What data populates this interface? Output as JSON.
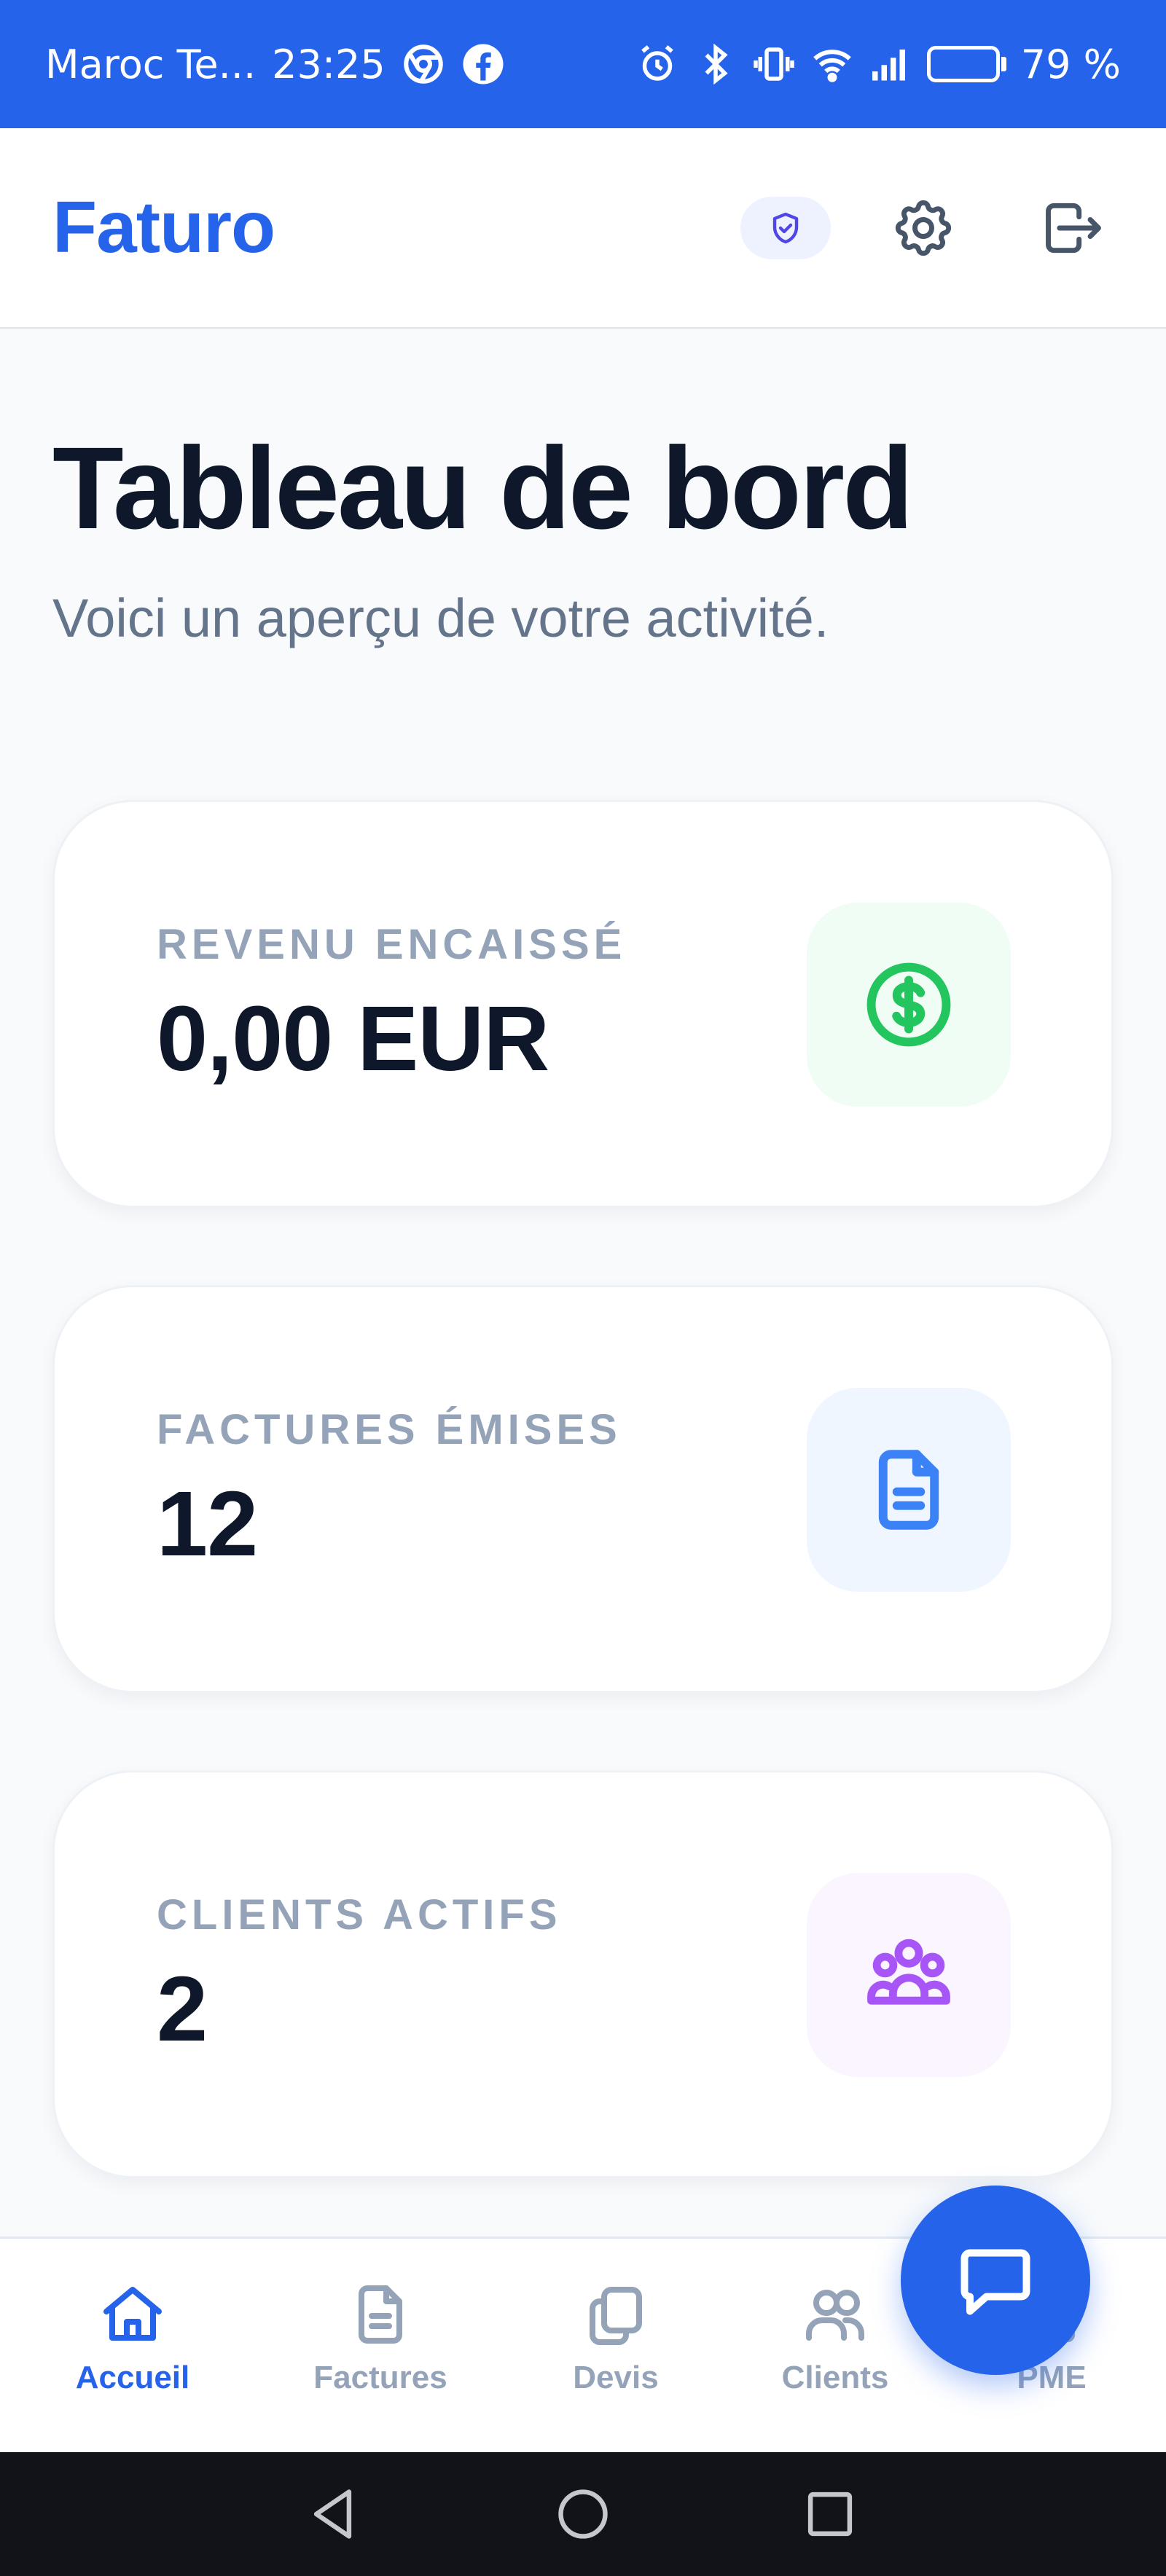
{
  "status_bar": {
    "carrier": "Maroc Te...",
    "time": "23:25",
    "battery": "79 %",
    "battery_level": 0.79,
    "icons": [
      "chrome-icon",
      "facebook-icon",
      "alarm-icon",
      "bluetooth-icon",
      "vibrate-icon",
      "wifi-icon",
      "signal-icon",
      "battery-icon"
    ]
  },
  "header": {
    "brand": "Faturo",
    "icons": [
      "shield-icon",
      "gear-icon",
      "logout-icon"
    ]
  },
  "main": {
    "title": "Tableau de bord",
    "subtitle": "Voici un aperçu de votre activité.",
    "cards": [
      {
        "label": "REVENU ENCAISSÉ",
        "value": "0,00 EUR",
        "icon": "dollar-icon",
        "icon_color": "#22c55e",
        "icon_bg": "#f0fdf4"
      },
      {
        "label": "FACTURES ÉMISES",
        "value": "12",
        "icon": "document-icon",
        "icon_color": "#3b82f6",
        "icon_bg": "#eff6ff"
      },
      {
        "label": "CLIENTS ACTIFS",
        "value": "2",
        "icon": "users-icon",
        "icon_color": "#a855f7",
        "icon_bg": "#faf5ff"
      }
    ]
  },
  "bottom_nav": {
    "items": [
      {
        "label": "Accueil",
        "icon": "home-icon",
        "active": true
      },
      {
        "label": "Factures",
        "icon": "document-icon",
        "active": false
      },
      {
        "label": "Devis",
        "icon": "copy-icon",
        "active": false
      },
      {
        "label": "Clients",
        "icon": "users-icon",
        "active": false
      },
      {
        "label": "PME",
        "icon": "building-icon",
        "active": false
      }
    ]
  },
  "fab": {
    "icon": "chat-icon"
  },
  "colors": {
    "primary": "#2563eb",
    "text": "#0f172a",
    "muted": "#64748b",
    "label": "#94a3b8",
    "background": "#f8fafc"
  }
}
